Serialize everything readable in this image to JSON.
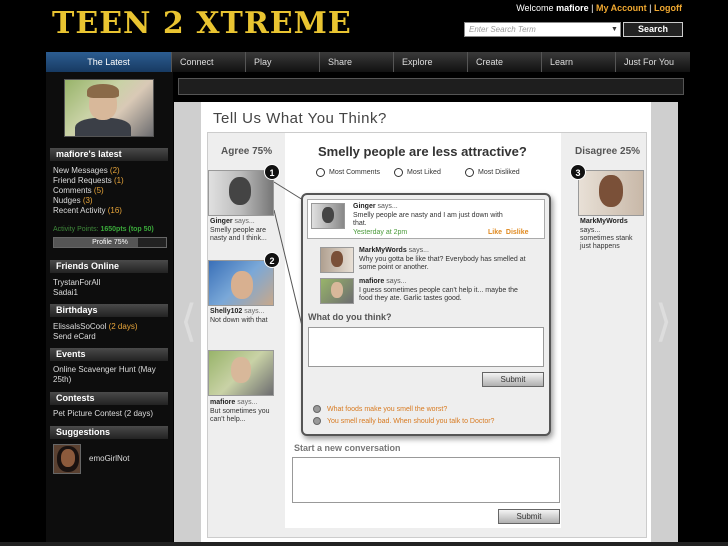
{
  "header": {
    "logo": "TEEN 2 XTREME",
    "welcome_prefix": "Welcome",
    "username": "mafiore",
    "separator": "|",
    "my_account": "My Account",
    "logoff": "Logoff",
    "search_placeholder": "Enter Search Term",
    "search_button": "Search"
  },
  "nav": [
    "The Latest",
    "Connect",
    "Play",
    "Share",
    "Explore",
    "Create",
    "Learn",
    "Just For You"
  ],
  "sidebar": {
    "latest_heading": "mafiore's latest",
    "latest_items": [
      {
        "label": "New Messages",
        "count": "(2)"
      },
      {
        "label": "Friend Requests",
        "count": "(1)"
      },
      {
        "label": "Comments",
        "count": "(5)"
      },
      {
        "label": "Nudges",
        "count": "(3)"
      },
      {
        "label": "Recent Activity",
        "count": "(16)"
      }
    ],
    "activity_label": "Activity Points:",
    "activity_points": "1650pts (top 50)",
    "profile_label": "Profile 75%",
    "profile_fraction": 0.75,
    "friends_heading": "Friends Online",
    "friends": [
      "TrystanForAll",
      "Sadai1"
    ],
    "birthdays_heading": "Birthdays",
    "birthday_name": "ElissalsSoCool",
    "birthday_when": "(2 days)",
    "birthday_action": "Send eCard",
    "events_heading": "Events",
    "event_line1": "Online Scavenger Hunt (May",
    "event_line2": "25th)",
    "contests_heading": "Contests",
    "contest": "Pet Picture Contest (2 days)",
    "suggestions_heading": "Suggestions",
    "suggestion_user": "emoGirlNot"
  },
  "content": {
    "title": "Tell Us What You Think?",
    "agree": "Agree 75%",
    "disagree": "Disagree 25%",
    "question": "Smelly people are less attractive?",
    "sort_options": [
      "Most Comments",
      "Most Liked",
      "Most Disliked"
    ],
    "left_users": [
      {
        "badge": "1",
        "name": "Ginger",
        "says": "says...",
        "line1": "Smelly people are",
        "line2": "nasty and I think..."
      },
      {
        "badge": "2",
        "name": "Shelly102",
        "says": "says...",
        "line1": "Not down with that",
        "line2": ""
      },
      {
        "badge": "",
        "name": "mafiore",
        "says": "says...",
        "line1": "But sometimes you",
        "line2": "can't help..."
      }
    ],
    "right_user": {
      "badge": "3",
      "name": "MarkMyWords",
      "says": "says...",
      "line1": "sometimes stank",
      "line2": "just happens"
    },
    "popup": {
      "first": {
        "name": "Ginger",
        "says": "says...",
        "line1": "Smelly people are nasty and I am just down with",
        "line2": "that.",
        "time": "Yesterday at 2pm",
        "like": "Like",
        "dislike": "Dislike"
      },
      "replies": [
        {
          "name": "MarkMyWords",
          "says": "says...",
          "line1": "Why you gotta be like that? Everybody has smelled at",
          "line2": "some point or another."
        },
        {
          "name": "mafiore",
          "says": "says...",
          "line1": "I guess sometimes people can't help it... maybe the",
          "line2": "food they ate. Garlic tastes good."
        }
      ],
      "prompt": "What do you think?",
      "submit": "Submit",
      "links": [
        "What foods make you smell the worst?",
        "You smell really bad. When should you talk to Doctor?"
      ]
    },
    "new_conversation": "Start a new conversation",
    "submit2": "Submit"
  }
}
